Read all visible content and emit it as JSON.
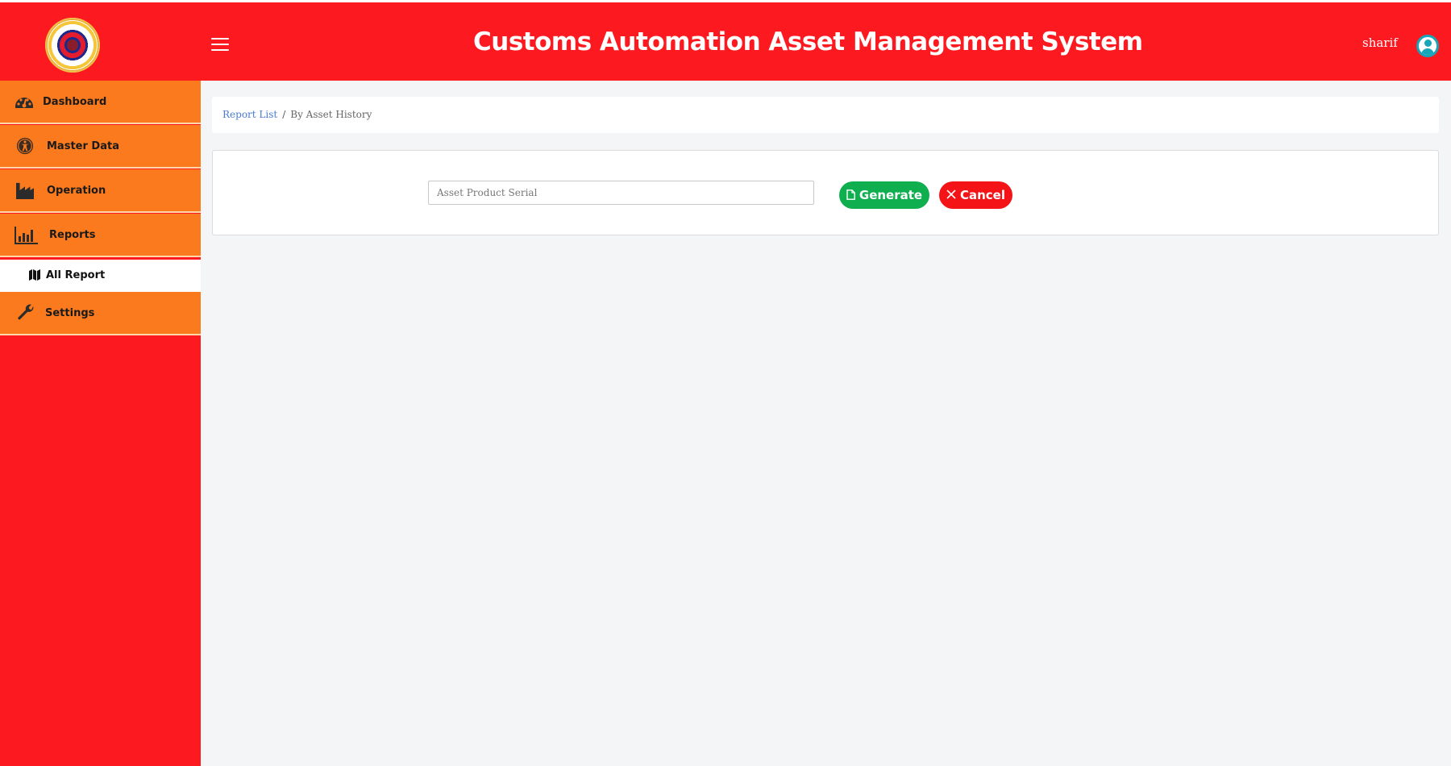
{
  "header": {
    "app_title": "Customs Automation Asset Management System",
    "username": "sharif",
    "logo_icon": "customs-seal-logo",
    "menu_icon": "hamburger-menu-icon",
    "avatar_icon": "user-avatar-icon"
  },
  "colors": {
    "header_bg": "#fc1a20",
    "sidebar_bg": "#fc1a20",
    "nav_item_bg": "#fb7a1d",
    "generate_button": "#0fae4e",
    "cancel_button": "#f41417",
    "breadcrumb_link": "#4a7bd0"
  },
  "sidebar": {
    "items": [
      {
        "label": "Dashboard",
        "icon": "speedometer-icon"
      },
      {
        "label": "Master Data",
        "icon": "accessibility-icon"
      },
      {
        "label": "Operation",
        "icon": "factory-icon"
      },
      {
        "label": "Reports",
        "icon": "bar-chart-icon"
      },
      {
        "label": "Settings",
        "icon": "wrench-icon"
      }
    ],
    "sub_items": [
      {
        "label": "All Report",
        "icon": "map-icon",
        "active": true
      }
    ]
  },
  "breadcrumb": {
    "link": "Report List",
    "separator": "/",
    "current": "By Asset History"
  },
  "form": {
    "serial_placeholder": "Asset Product Serial",
    "serial_value": "",
    "generate_label": "Generate",
    "cancel_label": "Cancel"
  }
}
